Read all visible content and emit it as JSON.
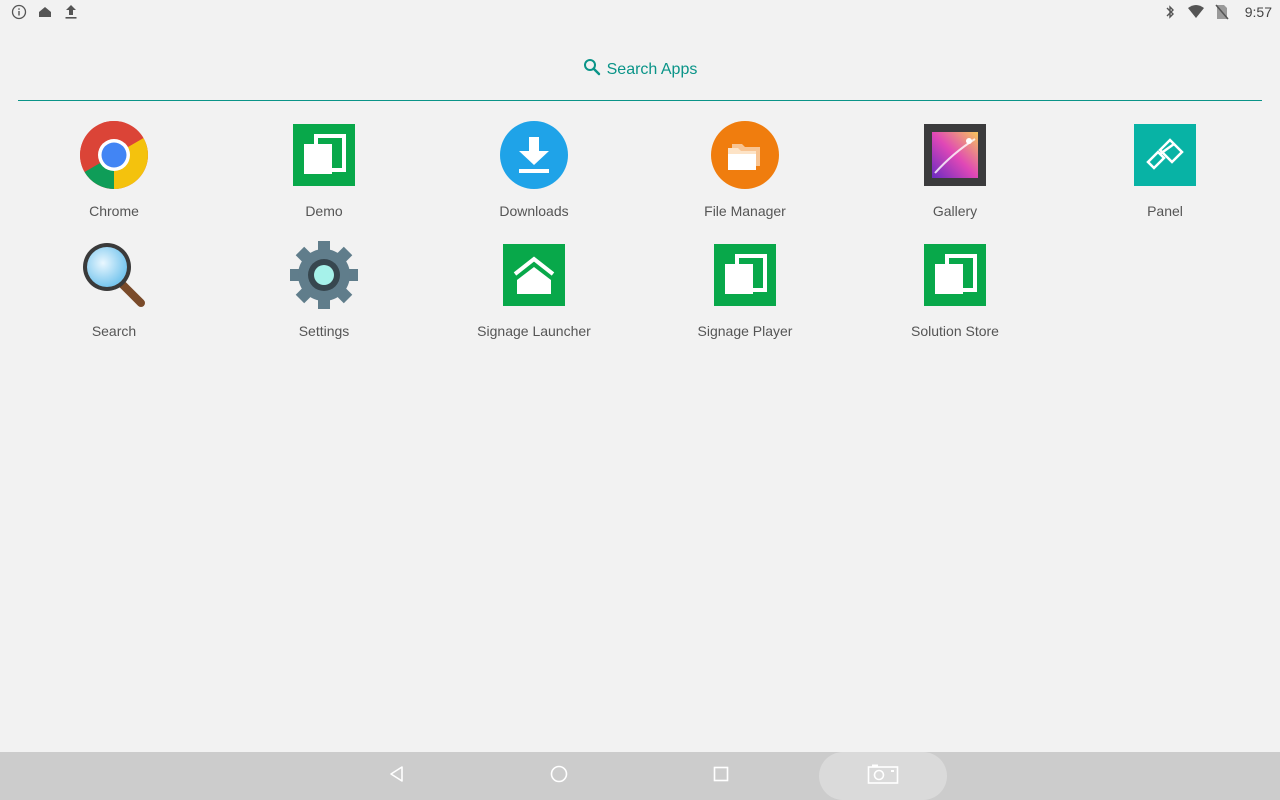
{
  "status_bar": {
    "time": "9:57",
    "left_icons": [
      "info-icon",
      "home-icon",
      "upload-icon"
    ],
    "right_icons": [
      "bluetooth-icon",
      "wifi-icon",
      "no-sim-icon"
    ]
  },
  "search": {
    "label": "Search Apps",
    "accent_color": "#0a9488"
  },
  "apps": [
    {
      "label": "Chrome",
      "icon": "chrome-icon"
    },
    {
      "label": "Demo",
      "icon": "demo-icon"
    },
    {
      "label": "Downloads",
      "icon": "downloads-icon"
    },
    {
      "label": "File Manager",
      "icon": "file-manager-icon"
    },
    {
      "label": "Gallery",
      "icon": "gallery-icon"
    },
    {
      "label": "Panel",
      "icon": "panel-icon"
    },
    {
      "label": "Search",
      "icon": "search-app-icon"
    },
    {
      "label": "Settings",
      "icon": "settings-icon"
    },
    {
      "label": "Signage Launcher",
      "icon": "signage-launcher-icon"
    },
    {
      "label": "Signage Player",
      "icon": "signage-player-icon"
    },
    {
      "label": "Solution Store",
      "icon": "solution-store-icon"
    }
  ],
  "nav_bar": {
    "buttons": [
      "back-icon",
      "home-icon",
      "recents-icon",
      "screenshot-icon"
    ]
  },
  "colors": {
    "background": "#f2f2f2",
    "nav_background": "#cccccc",
    "green_app": "#08a84a",
    "panel_teal": "#08b3a5"
  }
}
